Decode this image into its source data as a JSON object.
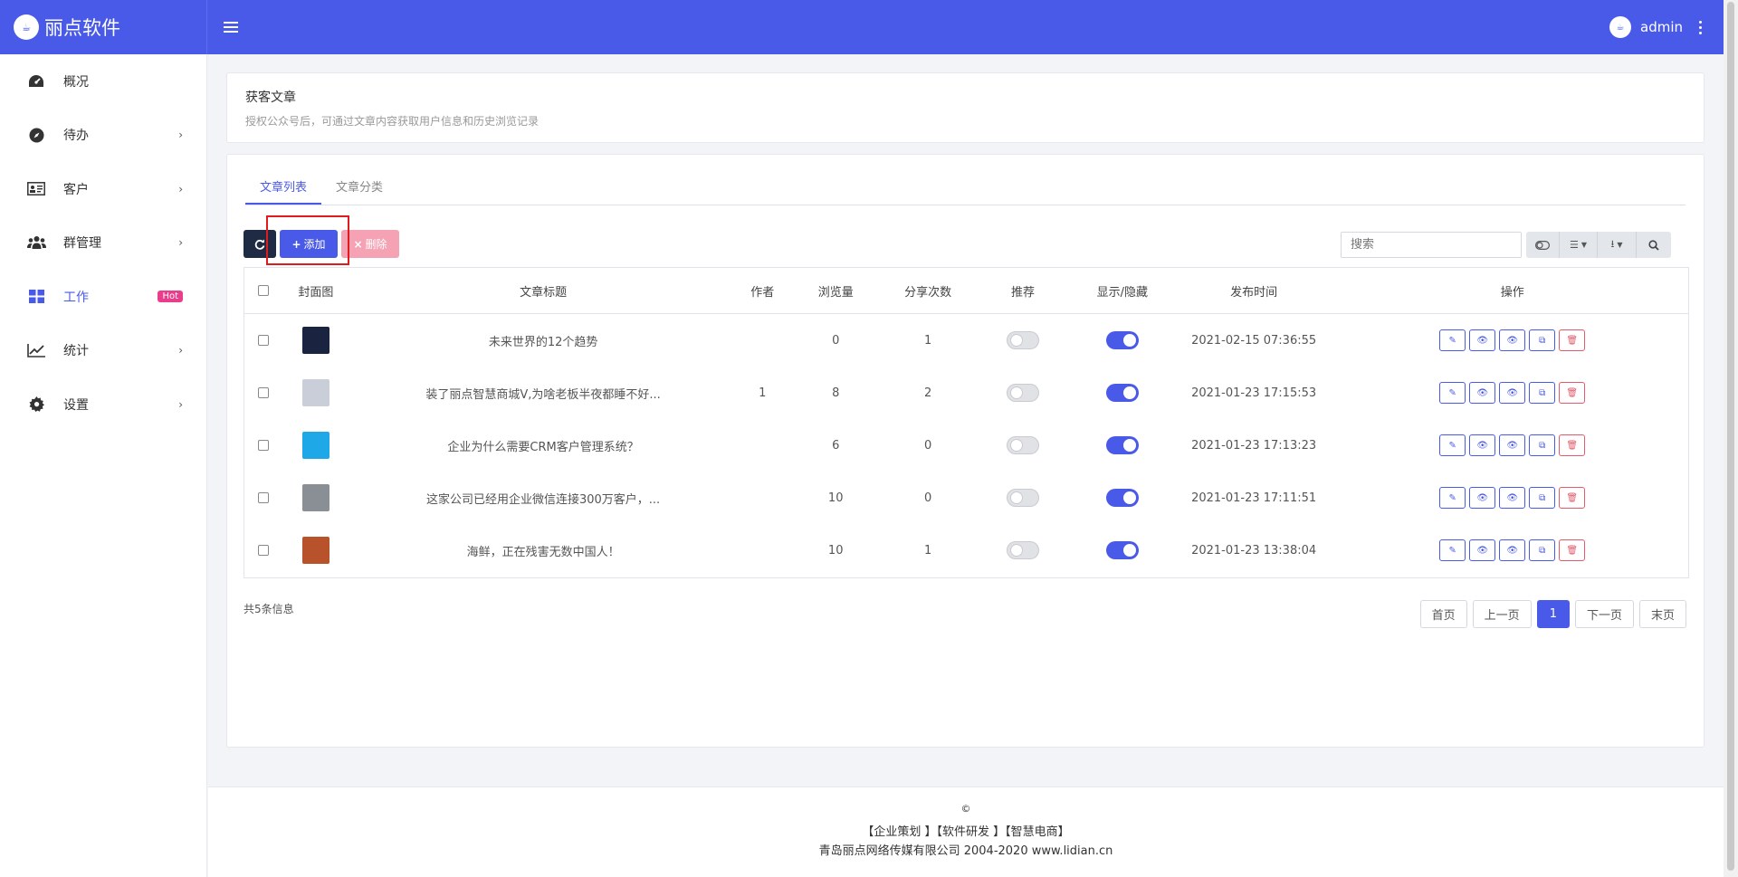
{
  "app": {
    "brand": "丽点软件",
    "user": "admin"
  },
  "sidebar": {
    "items": [
      {
        "label": "概况",
        "icon": "dashboard-icon",
        "chevron": false
      },
      {
        "label": "待办",
        "icon": "compass-icon",
        "chevron": true
      },
      {
        "label": "客户",
        "icon": "id-card-icon",
        "chevron": true
      },
      {
        "label": "群管理",
        "icon": "users-icon",
        "chevron": true
      },
      {
        "label": "工作",
        "icon": "grid-icon",
        "chevron": false,
        "badge": "Hot",
        "active": true
      },
      {
        "label": "统计",
        "icon": "line-chart-icon",
        "chevron": true
      },
      {
        "label": "设置",
        "icon": "gear-icon",
        "chevron": true
      }
    ]
  },
  "header_card": {
    "title": "获客文章",
    "subtitle": "授权公众号后，可通过文章内容获取用户信息和历史浏览记录"
  },
  "tabs": [
    "文章列表",
    "文章分类"
  ],
  "toolbar": {
    "add_label": "添加",
    "delete_label": "删除",
    "search_placeholder": "搜索"
  },
  "table": {
    "columns": [
      "封面图",
      "文章标题",
      "作者",
      "浏览量",
      "分享次数",
      "推荐",
      "显示/隐藏",
      "发布时间",
      "操作"
    ],
    "rows": [
      {
        "title": "未来世界的12个趋势",
        "author": "",
        "views": "0",
        "shares": "1",
        "recommend": false,
        "visible": true,
        "time": "2021-02-15 07:36:55",
        "cover_color": "#1a2340"
      },
      {
        "title": "装了丽点智慧商城V,为啥老板半夜都睡不好...",
        "author": "1",
        "views": "8",
        "shares": "2",
        "recommend": false,
        "visible": true,
        "time": "2021-01-23 17:15:53",
        "cover_color": "#c9ced8"
      },
      {
        "title": "企业为什么需要CRM客户管理系统？",
        "author": "",
        "views": "6",
        "shares": "0",
        "recommend": false,
        "visible": true,
        "time": "2021-01-23 17:13:23",
        "cover_color": "#1fa8e8"
      },
      {
        "title": "这家公司已经用企业微信连接300万客户，...",
        "author": "",
        "views": "10",
        "shares": "0",
        "recommend": false,
        "visible": true,
        "time": "2021-01-23 17:11:51",
        "cover_color": "#8a8f96"
      },
      {
        "title": "海鲜，正在残害无数中国人！",
        "author": "",
        "views": "10",
        "shares": "1",
        "recommend": false,
        "visible": true,
        "time": "2021-01-23 13:38:04",
        "cover_color": "#b8522a"
      }
    ]
  },
  "footer_info": {
    "total": "共5条信息"
  },
  "pager": {
    "first": "首页",
    "prev": "上一页",
    "current": "1",
    "next": "下一页",
    "last": "末页"
  },
  "footer": {
    "copyright": "©",
    "links": "【企业策划 】【软件研发 】【智慧电商】",
    "company": "青岛丽点网络传媒有限公司 2004-2020 www.lidian.cn"
  }
}
